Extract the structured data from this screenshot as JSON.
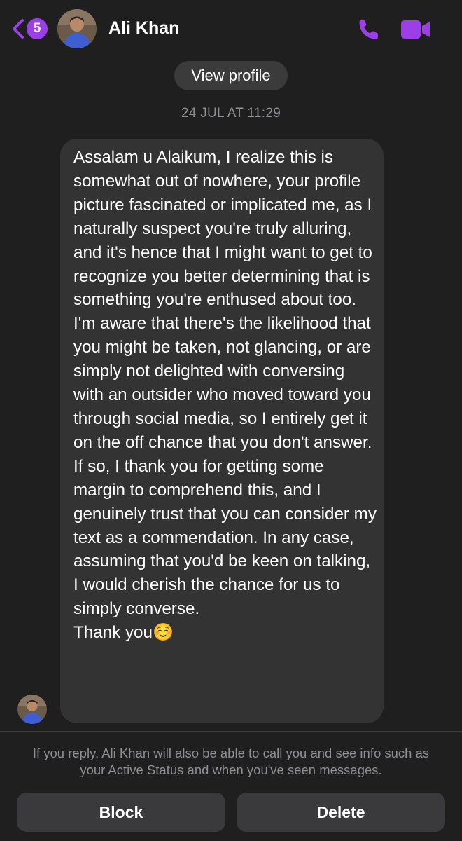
{
  "header": {
    "back_icon": "chevron-left-icon",
    "unread_count": "5",
    "contact_name": "Ali Khan",
    "call_icon": "phone-icon",
    "video_icon": "video-camera-icon"
  },
  "conversation": {
    "view_profile_label": "View profile",
    "timestamp": "24 JUL AT 11:29",
    "message": {
      "text": "Assalam u Alaikum, I realize this is somewhat out of nowhere, your profile picture fascinated or implicated me, as I naturally suspect you're truly alluring, and it's hence that I might want to get to recognize you better determining that is something you're enthused about too. I'm aware that there's the likelihood that you might be taken, not glancing, or are simply not delighted with conversing with an outsider who moved toward you through social media, so I entirely get it on the off chance that you don't answer. If so, I thank you for getting some margin to comprehend this, and I genuinely trust that you can consider my text as a commendation. In any case, assuming that you'd be keen on talking, I would cherish the chance for us to simply converse.\nThank you☺️"
    }
  },
  "footer": {
    "notice": "If you reply, Ali Khan will also be able to call you and see info such as your Active Status and when you've seen messages.",
    "block_label": "Block",
    "delete_label": "Delete"
  },
  "colors": {
    "accent": "#9d3fe7",
    "background": "#1f1f1f",
    "bubble": "#333333",
    "button": "#3a3a3c",
    "muted_text": "#8e8e93"
  }
}
